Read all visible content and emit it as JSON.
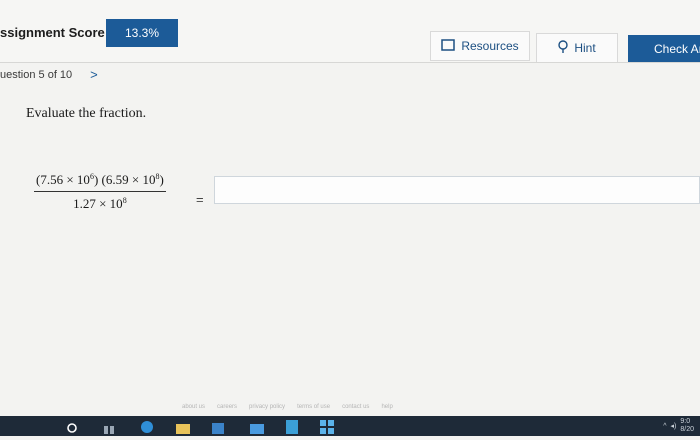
{
  "header": {
    "score_label": "ssignment Score:",
    "score_value": "13.3%",
    "resources_label": "Resources",
    "hint_label": "Hint",
    "check_label": "Check An"
  },
  "nav": {
    "question_label": "uestion 5 of 10",
    "next_symbol": ">"
  },
  "question": {
    "prompt": "Evaluate the fraction.",
    "num_a_coef": "7.56",
    "num_a_exp": "6",
    "num_b_coef": "6.59",
    "num_b_exp": "8",
    "den_coef": "1.27",
    "den_exp": "8",
    "equals": "=",
    "answer_value": ""
  },
  "footer": {
    "links": [
      "about us",
      "careers",
      "privacy policy",
      "terms of use",
      "contact us",
      "help"
    ]
  },
  "tray": {
    "clock_time": "9:0",
    "clock_date": "8/20"
  },
  "colors": {
    "accent": "#1c5b98",
    "taskbar": "#1e2a38"
  }
}
